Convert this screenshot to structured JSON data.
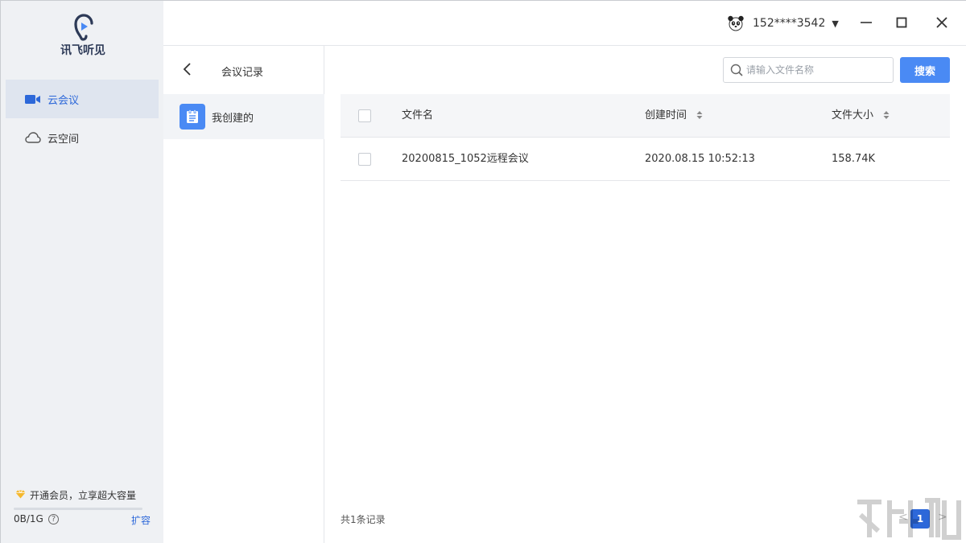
{
  "app": {
    "logo_text": "讯飞听见"
  },
  "sidebar": {
    "items": [
      {
        "label": "云会议",
        "icon": "video-camera-icon",
        "active": true
      },
      {
        "label": "云空间",
        "icon": "cloud-icon",
        "active": false
      }
    ],
    "vip_text": "开通会员，立享超大容量",
    "quota_text": "0B/1G",
    "quota_fraction": 0,
    "help_glyph": "?",
    "expand_label": "扩容"
  },
  "titlebar": {
    "user_name": "152****3542",
    "dropdown_glyph": "▼"
  },
  "midpane": {
    "title": "会议记录",
    "items": [
      {
        "label": "我创建的",
        "icon": "notepad-icon"
      }
    ]
  },
  "main": {
    "search": {
      "placeholder": "请输入文件名称",
      "value": "",
      "button_label": "搜索"
    },
    "table": {
      "columns": [
        "文件名",
        "创建时间",
        "文件大小"
      ],
      "rows": [
        {
          "name": "20200815_1052远程会议",
          "created": "2020.08.15 10:52:13",
          "size": "158.74K"
        }
      ]
    },
    "footer": {
      "count_text": "共1条记录",
      "page_prev": "<",
      "current_page": "1",
      "page_next": ">"
    }
  },
  "colors": {
    "accent": "#4a8af4",
    "active_nav_text": "#2d68d9",
    "sidebar_bg": "#eff1f4",
    "vip_gem": "#f5b82e"
  }
}
